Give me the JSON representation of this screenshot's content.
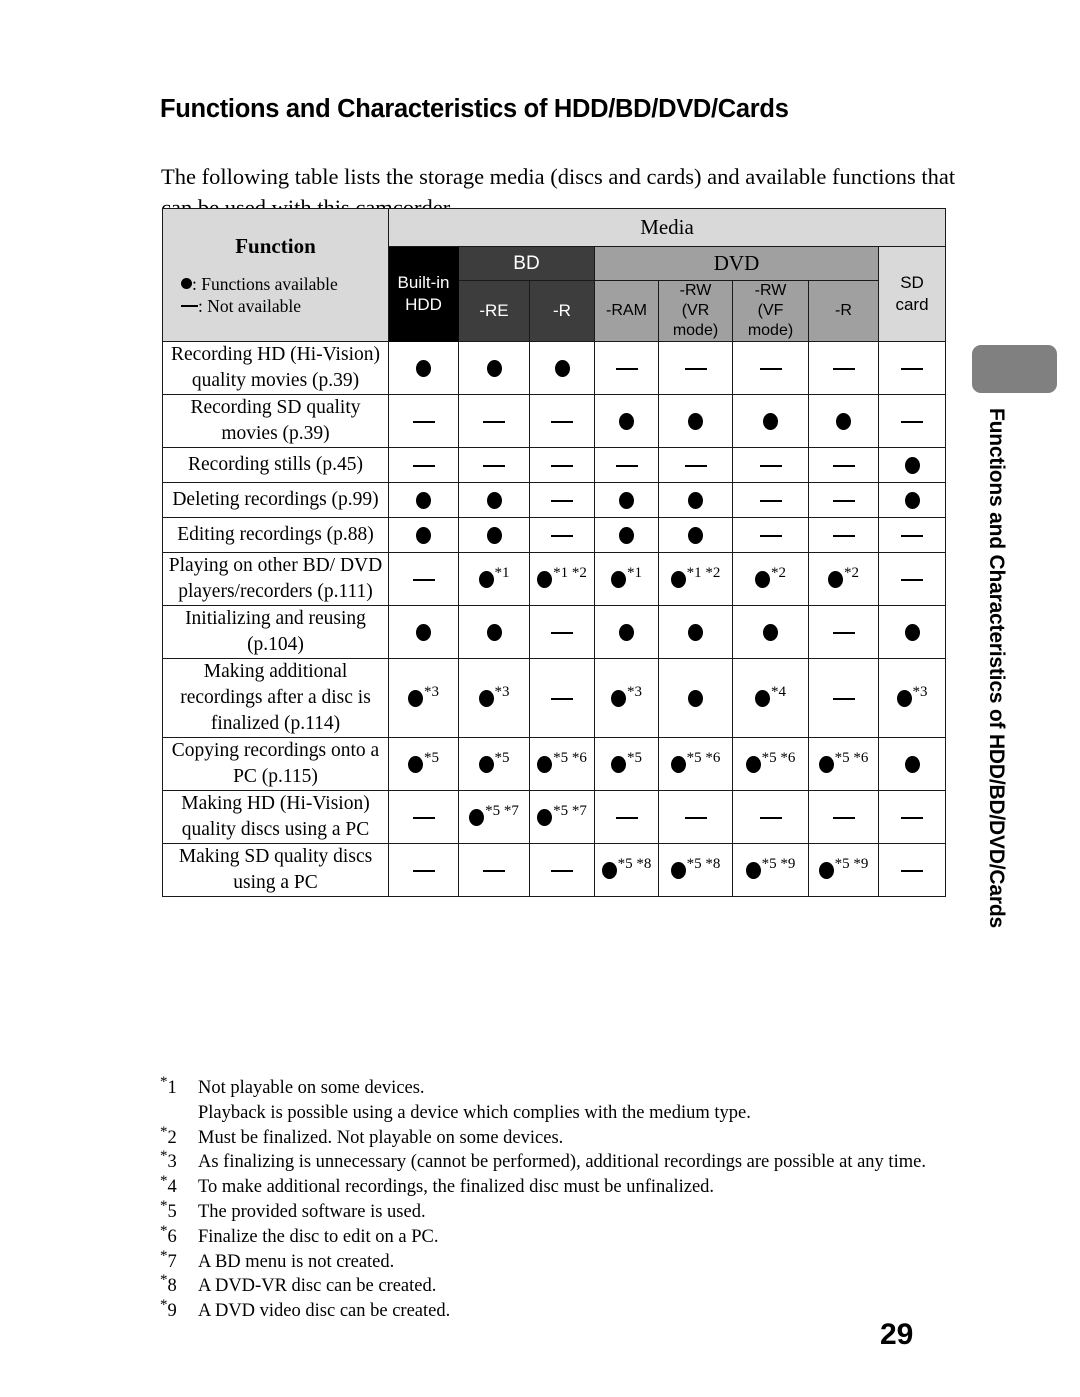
{
  "page": {
    "title": "Functions and Characteristics of HDD/BD/DVD/Cards",
    "intro": "The following table lists the storage media (discs and cards) and available functions that can be used with this camcorder.",
    "number": "29",
    "side_tab_title": "Functions and Characteristics of HDD/BD/DVD/Cards"
  },
  "table": {
    "function_header": "Function",
    "legend_available": ": Functions available",
    "legend_not_available": ": Not available",
    "media_header": "Media",
    "groups": {
      "bd": "BD",
      "dvd": "DVD"
    },
    "columns": [
      {
        "key": "hdd",
        "label_line1": "Built-in",
        "label_line2": "HDD"
      },
      {
        "key": "bdre",
        "label_line1": "-RE",
        "label_line2": ""
      },
      {
        "key": "bdr",
        "label_line1": "-R",
        "label_line2": ""
      },
      {
        "key": "ram",
        "label_line1": "-RAM",
        "label_line2": ""
      },
      {
        "key": "rwvr",
        "label_line1": "-RW",
        "label_line2": "(VR",
        "label_line3": "mode)"
      },
      {
        "key": "rwvf",
        "label_line1": "-RW",
        "label_line2": "(VF",
        "label_line3": "mode)"
      },
      {
        "key": "dvdr",
        "label_line1": "-R",
        "label_line2": ""
      },
      {
        "key": "sd",
        "label_line1": "SD",
        "label_line2": "card"
      }
    ],
    "rows": [
      {
        "function": "Recording HD (Hi-Vision) quality movies (p.39)",
        "values": [
          {
            "avail": true,
            "notes": ""
          },
          {
            "avail": true,
            "notes": ""
          },
          {
            "avail": true,
            "notes": ""
          },
          {
            "avail": false,
            "notes": ""
          },
          {
            "avail": false,
            "notes": ""
          },
          {
            "avail": false,
            "notes": ""
          },
          {
            "avail": false,
            "notes": ""
          },
          {
            "avail": false,
            "notes": ""
          }
        ]
      },
      {
        "function": "Recording SD quality movies (p.39)",
        "values": [
          {
            "avail": false,
            "notes": ""
          },
          {
            "avail": false,
            "notes": ""
          },
          {
            "avail": false,
            "notes": ""
          },
          {
            "avail": true,
            "notes": ""
          },
          {
            "avail": true,
            "notes": ""
          },
          {
            "avail": true,
            "notes": ""
          },
          {
            "avail": true,
            "notes": ""
          },
          {
            "avail": false,
            "notes": ""
          }
        ]
      },
      {
        "function": "Recording stills (p.45)",
        "values": [
          {
            "avail": false,
            "notes": ""
          },
          {
            "avail": false,
            "notes": ""
          },
          {
            "avail": false,
            "notes": ""
          },
          {
            "avail": false,
            "notes": ""
          },
          {
            "avail": false,
            "notes": ""
          },
          {
            "avail": false,
            "notes": ""
          },
          {
            "avail": false,
            "notes": ""
          },
          {
            "avail": true,
            "notes": ""
          }
        ]
      },
      {
        "function": "Deleting recordings (p.99)",
        "values": [
          {
            "avail": true,
            "notes": ""
          },
          {
            "avail": true,
            "notes": ""
          },
          {
            "avail": false,
            "notes": ""
          },
          {
            "avail": true,
            "notes": ""
          },
          {
            "avail": true,
            "notes": ""
          },
          {
            "avail": false,
            "notes": ""
          },
          {
            "avail": false,
            "notes": ""
          },
          {
            "avail": true,
            "notes": ""
          }
        ]
      },
      {
        "function": "Editing recordings (p.88)",
        "values": [
          {
            "avail": true,
            "notes": ""
          },
          {
            "avail": true,
            "notes": ""
          },
          {
            "avail": false,
            "notes": ""
          },
          {
            "avail": true,
            "notes": ""
          },
          {
            "avail": true,
            "notes": ""
          },
          {
            "avail": false,
            "notes": ""
          },
          {
            "avail": false,
            "notes": ""
          },
          {
            "avail": false,
            "notes": ""
          }
        ]
      },
      {
        "function": "Playing on other BD/ DVD players/recorders (p.111)",
        "values": [
          {
            "avail": false,
            "notes": ""
          },
          {
            "avail": true,
            "notes": "*1"
          },
          {
            "avail": true,
            "notes": "*1 *2"
          },
          {
            "avail": true,
            "notes": "*1"
          },
          {
            "avail": true,
            "notes": "*1 *2"
          },
          {
            "avail": true,
            "notes": "*2"
          },
          {
            "avail": true,
            "notes": "*2"
          },
          {
            "avail": false,
            "notes": ""
          }
        ]
      },
      {
        "function": "Initializing and reusing (p.104)",
        "values": [
          {
            "avail": true,
            "notes": ""
          },
          {
            "avail": true,
            "notes": ""
          },
          {
            "avail": false,
            "notes": ""
          },
          {
            "avail": true,
            "notes": ""
          },
          {
            "avail": true,
            "notes": ""
          },
          {
            "avail": true,
            "notes": ""
          },
          {
            "avail": false,
            "notes": ""
          },
          {
            "avail": true,
            "notes": ""
          }
        ]
      },
      {
        "function": "Making additional recordings after a disc is finalized (p.114)",
        "values": [
          {
            "avail": true,
            "notes": "*3"
          },
          {
            "avail": true,
            "notes": "*3"
          },
          {
            "avail": false,
            "notes": ""
          },
          {
            "avail": true,
            "notes": "*3"
          },
          {
            "avail": true,
            "notes": ""
          },
          {
            "avail": true,
            "notes": "*4"
          },
          {
            "avail": false,
            "notes": ""
          },
          {
            "avail": true,
            "notes": "*3"
          }
        ]
      },
      {
        "function": "Copying recordings onto a PC (p.115)",
        "values": [
          {
            "avail": true,
            "notes": "*5"
          },
          {
            "avail": true,
            "notes": "*5"
          },
          {
            "avail": true,
            "notes": "*5 *6"
          },
          {
            "avail": true,
            "notes": "*5"
          },
          {
            "avail": true,
            "notes": "*5 *6"
          },
          {
            "avail": true,
            "notes": "*5 *6"
          },
          {
            "avail": true,
            "notes": "*5 *6"
          },
          {
            "avail": true,
            "notes": ""
          }
        ]
      },
      {
        "function": "Making HD (Hi-Vision) quality discs using a PC",
        "values": [
          {
            "avail": false,
            "notes": ""
          },
          {
            "avail": true,
            "notes": "*5 *7"
          },
          {
            "avail": true,
            "notes": "*5 *7"
          },
          {
            "avail": false,
            "notes": ""
          },
          {
            "avail": false,
            "notes": ""
          },
          {
            "avail": false,
            "notes": ""
          },
          {
            "avail": false,
            "notes": ""
          },
          {
            "avail": false,
            "notes": ""
          }
        ]
      },
      {
        "function": "Making SD quality discs using a PC",
        "values": [
          {
            "avail": false,
            "notes": ""
          },
          {
            "avail": false,
            "notes": ""
          },
          {
            "avail": false,
            "notes": ""
          },
          {
            "avail": true,
            "notes": "*5 *8"
          },
          {
            "avail": true,
            "notes": "*5 *8"
          },
          {
            "avail": true,
            "notes": "*5 *9"
          },
          {
            "avail": true,
            "notes": "*5 *9"
          },
          {
            "avail": false,
            "notes": ""
          }
        ]
      }
    ]
  },
  "footnotes": [
    {
      "num": "1",
      "text": "Not playable on some devices.\nPlayback is possible using a device which complies with the medium type."
    },
    {
      "num": "2",
      "text": "Must be finalized. Not playable on some devices."
    },
    {
      "num": "3",
      "text": "As finalizing is unnecessary (cannot be performed), additional recordings are possible at any time."
    },
    {
      "num": "4",
      "text": "To make additional recordings, the finalized disc must be unfinalized."
    },
    {
      "num": "5",
      "text": "The provided software is used."
    },
    {
      "num": "6",
      "text": "Finalize the disc to edit on a PC."
    },
    {
      "num": "7",
      "text": "A BD menu is not created."
    },
    {
      "num": "8",
      "text": "A DVD-VR disc can be created."
    },
    {
      "num": "9",
      "text": "A DVD video disc can be created."
    }
  ],
  "colors": {
    "hdd_header_bg": "#000000",
    "bd_header_bg": "#3d3d3d",
    "dvd_header_bg": "#a0a0a0",
    "sd_header_bg": "#d9d9d9",
    "function_header_bg": "#d9d9d9",
    "side_tab_bg": "#808080"
  }
}
